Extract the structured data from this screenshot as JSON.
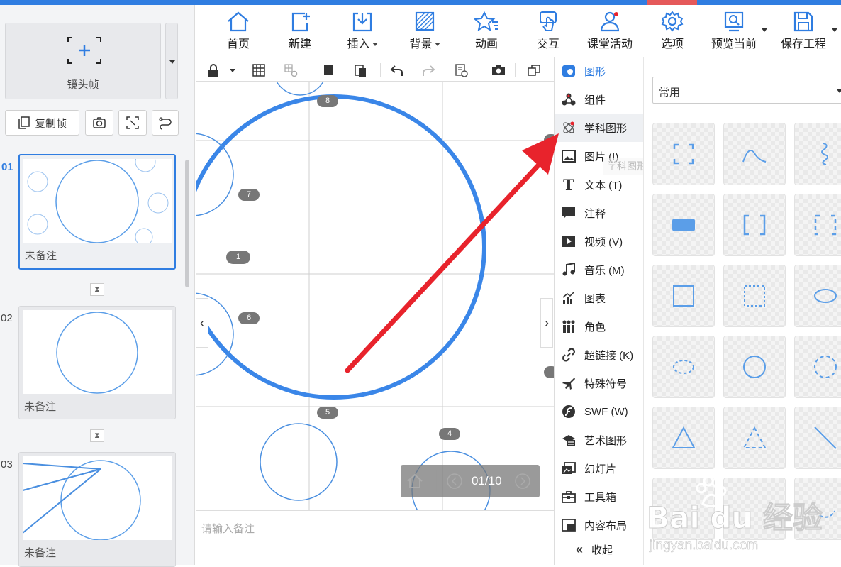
{
  "toolbar": {
    "items": [
      {
        "label": "首页",
        "icon": "home-icon"
      },
      {
        "label": "新建",
        "icon": "new-icon"
      },
      {
        "label": "插入",
        "icon": "insert-icon"
      },
      {
        "label": "背景",
        "icon": "background-icon"
      },
      {
        "label": "动画",
        "icon": "animation-icon"
      },
      {
        "label": "交互",
        "icon": "interaction-icon"
      },
      {
        "label": "课堂活动",
        "icon": "classroom-activity-icon"
      },
      {
        "label": "选项",
        "icon": "options-icon"
      },
      {
        "label": "预览当前",
        "icon": "preview-icon"
      },
      {
        "label": "保存工程",
        "icon": "save-icon"
      }
    ]
  },
  "left": {
    "add_frame_label": "镜头帧",
    "copy_frame_label": "复制帧",
    "thumbs": [
      {
        "num": "01",
        "note": "未备注"
      },
      {
        "num": "02",
        "note": "未备注"
      },
      {
        "num": "03",
        "note": "未备注"
      }
    ]
  },
  "canvas": {
    "frame_labels": [
      "8",
      "7",
      "1",
      "6",
      "5",
      "4"
    ],
    "player_page": "01/10"
  },
  "notes": {
    "placeholder": "请输入备注"
  },
  "menu": {
    "items": [
      {
        "label": "图形",
        "icon": "shape-icon"
      },
      {
        "label": "组件",
        "icon": "component-icon"
      },
      {
        "label": "学科图形",
        "icon": "subject-shape-icon"
      },
      {
        "label": "图片 (I)",
        "icon": "image-icon"
      },
      {
        "label": "文本 (T)",
        "icon": "text-icon"
      },
      {
        "label": "注释",
        "icon": "comment-icon"
      },
      {
        "label": "视频 (V)",
        "icon": "video-icon"
      },
      {
        "label": "音乐 (M)",
        "icon": "music-icon"
      },
      {
        "label": "图表",
        "icon": "chart-icon"
      },
      {
        "label": "角色",
        "icon": "role-icon"
      },
      {
        "label": "超链接 (K)",
        "icon": "link-icon"
      },
      {
        "label": "特殊符号",
        "icon": "special-symbol-icon"
      },
      {
        "label": "SWF (W)",
        "icon": "swf-icon"
      },
      {
        "label": "艺术图形",
        "icon": "art-shape-icon"
      },
      {
        "label": "幻灯片",
        "icon": "slide-icon"
      },
      {
        "label": "工具箱",
        "icon": "toolbox-icon"
      },
      {
        "label": "内容布局",
        "icon": "layout-icon"
      },
      {
        "label": "收起",
        "icon": "collapse-icon"
      }
    ],
    "tooltip": "学科图形"
  },
  "shapes": {
    "category": "常用"
  },
  "watermark": {
    "main": "Bai du 经验",
    "sub": "jingyan.baidu.com"
  },
  "colors": {
    "accent": "#2f7de1",
    "arrow": "#e8232c",
    "shape_blue": "#5b9ee8"
  }
}
